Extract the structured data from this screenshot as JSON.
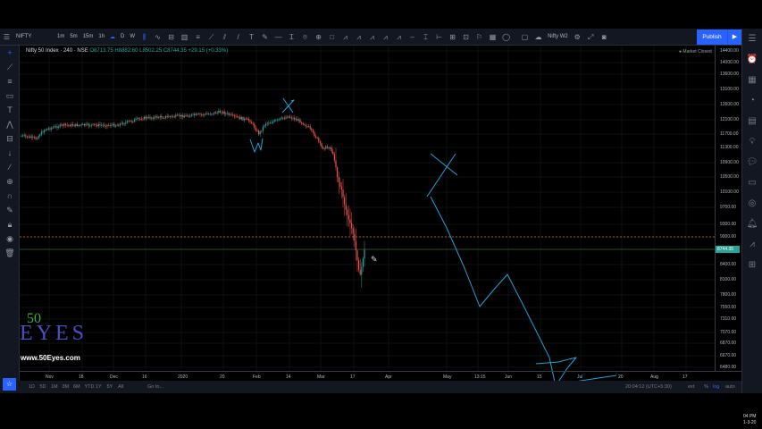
{
  "toolbar": {
    "symbol": "NIFTY",
    "intervals": [
      "1m",
      "5m",
      "15m",
      "1h",
      "D",
      "W"
    ],
    "layout_name": "Nifty W2",
    "publish": "Publish"
  },
  "legend": {
    "title": "Nifty 50 Index · 240 · NSE",
    "open": "O8713.75",
    "high": "H8882.60",
    "low": "L8502.25",
    "close": "C8744.35",
    "change": "+29.15 (+0.33%)"
  },
  "market_status": "● Market Closed",
  "price_axis": [
    "14400.00",
    "14000.00",
    "13600.00",
    "13100.00",
    "12600.00",
    "12100.00",
    "11700.00",
    "11300.00",
    "10900.00",
    "10500.00",
    "10100.00",
    "9700.00",
    "9300.00",
    "9000.00",
    "8400.00",
    "8100.00",
    "7800.00",
    "7550.00",
    "7310.00",
    "7070.00",
    "6870.00",
    "6670.00",
    "6480.00"
  ],
  "last_price": "8744.35",
  "time_axis": [
    "Nov",
    "18",
    "Dec",
    "16",
    "2020",
    "20",
    "Feb",
    "14",
    "Mar",
    "17",
    "Apr",
    "May",
    "13:15",
    "Jun",
    "15",
    "Jul",
    "20",
    "Aug",
    "17"
  ],
  "ranges": [
    "1D",
    "5D",
    "1M",
    "3M",
    "6M",
    "YTD",
    "1Y",
    "5Y",
    "All"
  ],
  "goto": "Go to...",
  "clock_utc": "20:04:12 (UTC+5:30)",
  "scale_opts": [
    "ext",
    "%",
    "log",
    "auto"
  ],
  "logo": {
    "num": "50",
    "word": "EYES",
    "url": "www.50Eyes.com"
  },
  "os_clock": {
    "time": "04 PM",
    "date": "1-3-20"
  },
  "colors": {
    "up": "#26a69a",
    "down": "#ef5350",
    "drawing": "#1fa3d8",
    "accent": "#2962ff"
  }
}
